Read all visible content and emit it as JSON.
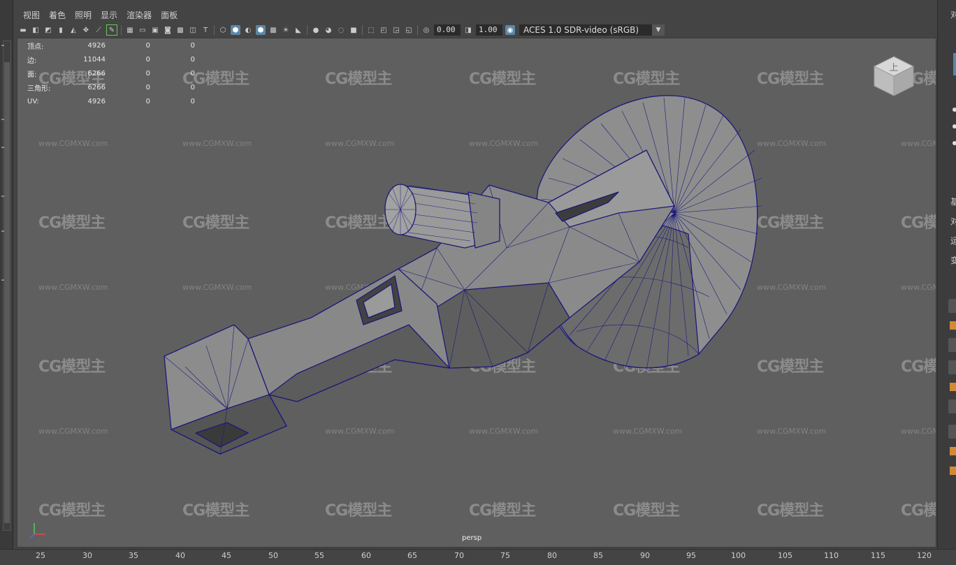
{
  "menu": [
    "视图",
    "着色",
    "照明",
    "显示",
    "渲染器",
    "面板"
  ],
  "toolbar": {
    "exposure": "0.00",
    "gamma": "1.00",
    "color_management": "ACES 1.0 SDR-video (sRGB)"
  },
  "hud": [
    {
      "label": "顶点:",
      "v1": "4926",
      "v2": "0",
      "v3": "0"
    },
    {
      "label": "边:",
      "v1": "11044",
      "v2": "0",
      "v3": "0"
    },
    {
      "label": "面:",
      "v1": "6266",
      "v2": "0",
      "v3": "0"
    },
    {
      "label": "三角形:",
      "v1": "6266",
      "v2": "0",
      "v3": "0"
    },
    {
      "label": "UV:",
      "v1": "4926",
      "v2": "0",
      "v3": "0"
    }
  ],
  "viewcube_label": "上",
  "camera_label": "persp",
  "watermark": {
    "logo": "CG模型主",
    "url": "www.CGMXW.com"
  },
  "ruler": [
    "25",
    "30",
    "35",
    "40",
    "45",
    "50",
    "55",
    "60",
    "65",
    "70",
    "75",
    "80",
    "85",
    "90",
    "95",
    "100",
    "105",
    "110",
    "115",
    "120"
  ],
  "right_panel": [
    "对",
    "基",
    "对",
    "运",
    "变"
  ]
}
